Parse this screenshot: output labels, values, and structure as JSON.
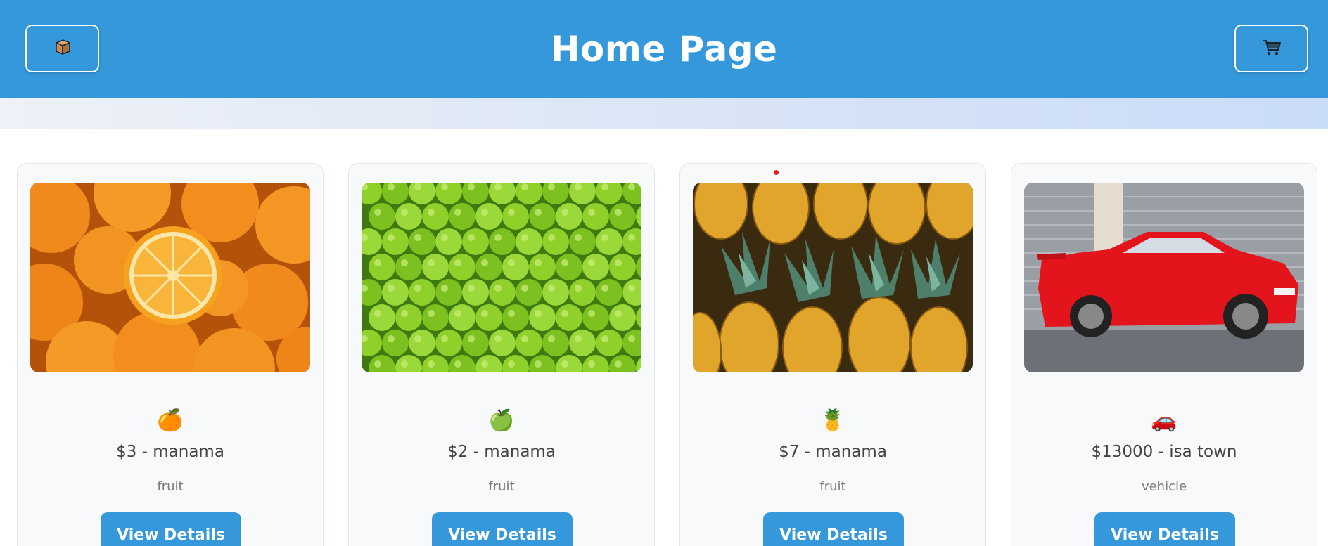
{
  "header": {
    "title": "Home Page",
    "left_icon": "package-icon",
    "right_icon": "cart-icon"
  },
  "colors": {
    "primary": "#3498db",
    "card_bg": "#f7f9fb"
  },
  "products": [
    {
      "emoji": "🍊",
      "price_location": "$3 - manama",
      "category": "fruit",
      "button": "View Details",
      "image": "oranges"
    },
    {
      "emoji": "🍏",
      "price_location": "$2 - manama",
      "category": "fruit",
      "button": "View Details",
      "image": "green-apples"
    },
    {
      "emoji": "🍍",
      "price_location": "$7 - manama",
      "category": "fruit",
      "button": "View Details",
      "image": "pineapples"
    },
    {
      "emoji": "🚗",
      "price_location": "$13000 - isa town",
      "category": "vehicle",
      "button": "View Details",
      "image": "red-car"
    }
  ]
}
